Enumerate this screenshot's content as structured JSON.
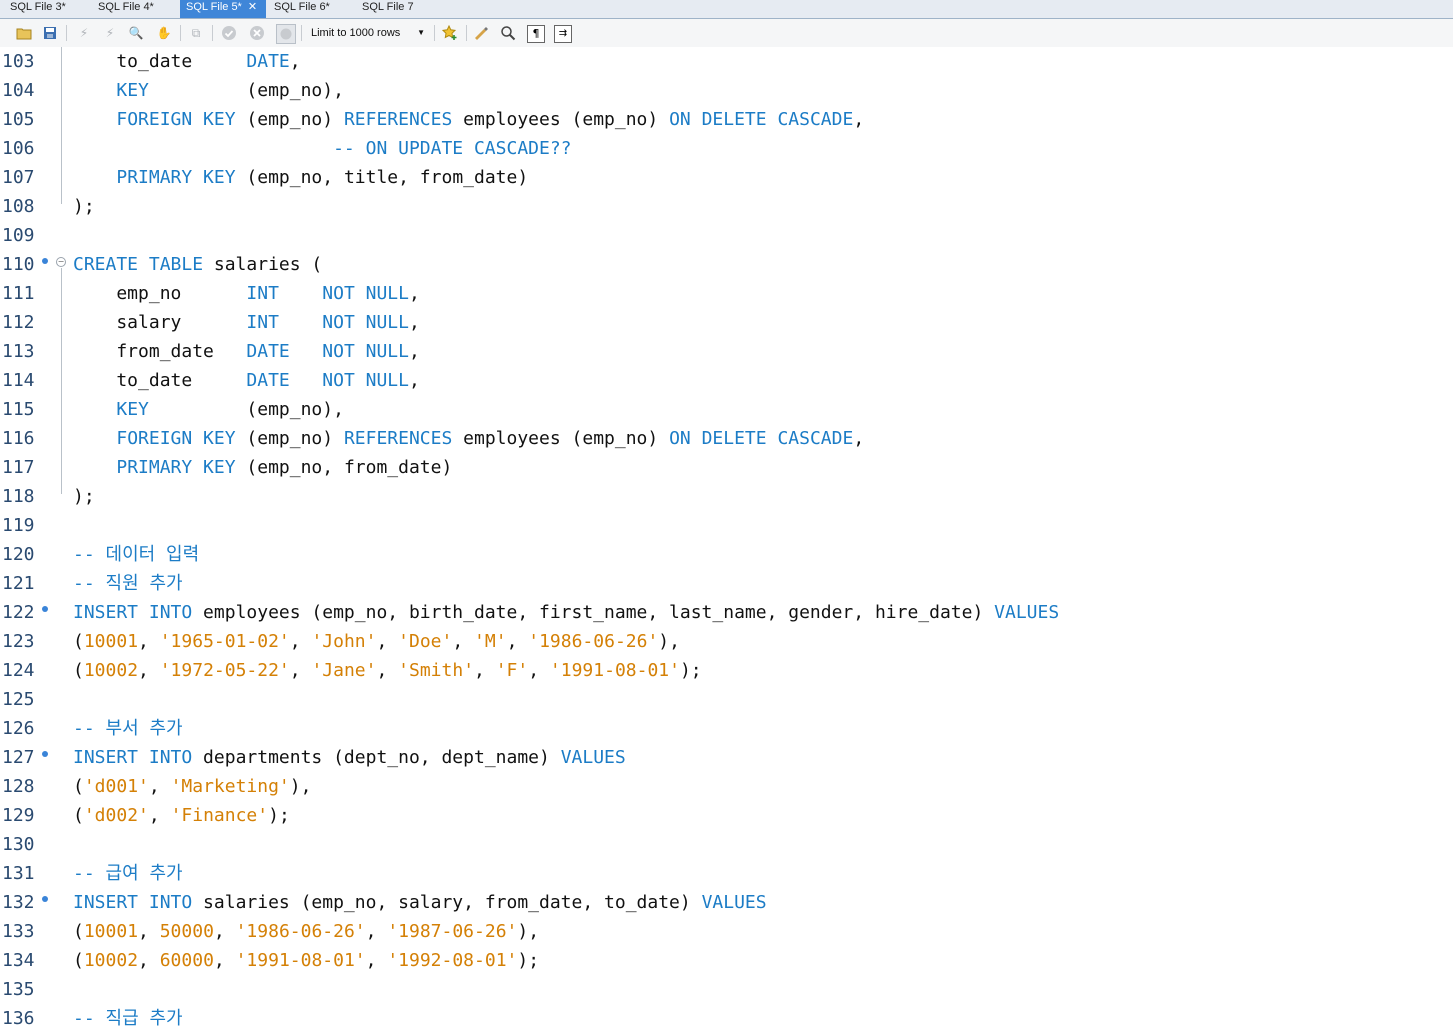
{
  "tabs": [
    {
      "label": "SQL File 3*",
      "active": false,
      "closable": false
    },
    {
      "label": "SQL File 4*",
      "active": false,
      "closable": false
    },
    {
      "label": "SQL File 5*",
      "active": true,
      "closable": true
    },
    {
      "label": "SQL File 6*",
      "active": false,
      "closable": false
    },
    {
      "label": "SQL File 7",
      "active": false,
      "closable": false
    }
  ],
  "toolbar": {
    "limit_label": "Limit to 1000 rows",
    "icons": [
      "open-folder-icon",
      "save-icon",
      "execute-icon",
      "execute-selection-icon",
      "explain-icon",
      "stop-icon",
      "toggle-continue-icon",
      "commit-icon",
      "rollback-icon",
      "autocommit-icon",
      "limit-dropdown",
      "add-snippet-icon",
      "beautify-icon",
      "find-icon",
      "invisible-chars-icon",
      "wrap-icon"
    ]
  },
  "colors": {
    "keyword": "#1c7cc6",
    "string": "#d48006",
    "line_number": "#2a4a70",
    "active_tab": "#3f86d8"
  },
  "lines": [
    {
      "n": "103",
      "marker": false,
      "fold": false,
      "segs": [
        [
          "p",
          "    to_date     "
        ],
        [
          "k",
          "DATE"
        ],
        [
          "p",
          ","
        ]
      ]
    },
    {
      "n": "104",
      "marker": false,
      "fold": false,
      "segs": [
        [
          "p",
          "    "
        ],
        [
          "k",
          "KEY"
        ],
        [
          "p",
          "         (emp_no),"
        ]
      ]
    },
    {
      "n": "105",
      "marker": false,
      "fold": false,
      "segs": [
        [
          "p",
          "    "
        ],
        [
          "k",
          "FOREIGN KEY"
        ],
        [
          "p",
          " (emp_no) "
        ],
        [
          "k",
          "REFERENCES"
        ],
        [
          "p",
          " employees (emp_no) "
        ],
        [
          "k",
          "ON DELETE CASCADE"
        ],
        [
          "p",
          ","
        ]
      ]
    },
    {
      "n": "106",
      "marker": false,
      "fold": false,
      "segs": [
        [
          "p",
          "                        "
        ],
        [
          "c",
          "-- ON UPDATE CASCADE??"
        ]
      ]
    },
    {
      "n": "107",
      "marker": false,
      "fold": false,
      "segs": [
        [
          "p",
          "    "
        ],
        [
          "k",
          "PRIMARY KEY"
        ],
        [
          "p",
          " (emp_no, title, from_date)"
        ]
      ]
    },
    {
      "n": "108",
      "marker": false,
      "fold": false,
      "segs": [
        [
          "p",
          ");"
        ]
      ]
    },
    {
      "n": "109",
      "marker": false,
      "fold": false,
      "segs": []
    },
    {
      "n": "110",
      "marker": true,
      "fold": true,
      "segs": [
        [
          "k",
          "CREATE TABLE"
        ],
        [
          "p",
          " salaries ("
        ]
      ]
    },
    {
      "n": "111",
      "marker": false,
      "fold": false,
      "segs": [
        [
          "p",
          "    emp_no      "
        ],
        [
          "k",
          "INT"
        ],
        [
          "p",
          "    "
        ],
        [
          "k",
          "NOT NULL"
        ],
        [
          "p",
          ","
        ]
      ]
    },
    {
      "n": "112",
      "marker": false,
      "fold": false,
      "segs": [
        [
          "p",
          "    salary      "
        ],
        [
          "k",
          "INT"
        ],
        [
          "p",
          "    "
        ],
        [
          "k",
          "NOT NULL"
        ],
        [
          "p",
          ","
        ]
      ]
    },
    {
      "n": "113",
      "marker": false,
      "fold": false,
      "segs": [
        [
          "p",
          "    from_date   "
        ],
        [
          "k",
          "DATE"
        ],
        [
          "p",
          "   "
        ],
        [
          "k",
          "NOT NULL"
        ],
        [
          "p",
          ","
        ]
      ]
    },
    {
      "n": "114",
      "marker": false,
      "fold": false,
      "segs": [
        [
          "p",
          "    to_date     "
        ],
        [
          "k",
          "DATE"
        ],
        [
          "p",
          "   "
        ],
        [
          "k",
          "NOT NULL"
        ],
        [
          "p",
          ","
        ]
      ]
    },
    {
      "n": "115",
      "marker": false,
      "fold": false,
      "segs": [
        [
          "p",
          "    "
        ],
        [
          "k",
          "KEY"
        ],
        [
          "p",
          "         (emp_no),"
        ]
      ]
    },
    {
      "n": "116",
      "marker": false,
      "fold": false,
      "segs": [
        [
          "p",
          "    "
        ],
        [
          "k",
          "FOREIGN KEY"
        ],
        [
          "p",
          " (emp_no) "
        ],
        [
          "k",
          "REFERENCES"
        ],
        [
          "p",
          " employees (emp_no) "
        ],
        [
          "k",
          "ON DELETE CASCADE"
        ],
        [
          "p",
          ","
        ]
      ]
    },
    {
      "n": "117",
      "marker": false,
      "fold": false,
      "segs": [
        [
          "p",
          "    "
        ],
        [
          "k",
          "PRIMARY KEY"
        ],
        [
          "p",
          " (emp_no, from_date)"
        ]
      ]
    },
    {
      "n": "118",
      "marker": false,
      "fold": false,
      "segs": [
        [
          "p",
          ");"
        ]
      ]
    },
    {
      "n": "119",
      "marker": false,
      "fold": false,
      "segs": []
    },
    {
      "n": "120",
      "marker": false,
      "fold": false,
      "segs": [
        [
          "c",
          "-- 데이터 입력"
        ]
      ]
    },
    {
      "n": "121",
      "marker": false,
      "fold": false,
      "segs": [
        [
          "c",
          "-- 직원 추가"
        ]
      ]
    },
    {
      "n": "122",
      "marker": true,
      "fold": false,
      "segs": [
        [
          "k",
          "INSERT INTO"
        ],
        [
          "p",
          " employees (emp_no, birth_date, first_name, last_name, gender, hire_date) "
        ],
        [
          "k",
          "VALUES"
        ]
      ]
    },
    {
      "n": "123",
      "marker": false,
      "fold": false,
      "segs": [
        [
          "p",
          "("
        ],
        [
          "s",
          "10001"
        ],
        [
          "p",
          ", "
        ],
        [
          "s",
          "'1965-01-02'"
        ],
        [
          "p",
          ", "
        ],
        [
          "s",
          "'John'"
        ],
        [
          "p",
          ", "
        ],
        [
          "s",
          "'Doe'"
        ],
        [
          "p",
          ", "
        ],
        [
          "s",
          "'M'"
        ],
        [
          "p",
          ", "
        ],
        [
          "s",
          "'1986-06-26'"
        ],
        [
          "p",
          "),"
        ]
      ]
    },
    {
      "n": "124",
      "marker": false,
      "fold": false,
      "segs": [
        [
          "p",
          "("
        ],
        [
          "s",
          "10002"
        ],
        [
          "p",
          ", "
        ],
        [
          "s",
          "'1972-05-22'"
        ],
        [
          "p",
          ", "
        ],
        [
          "s",
          "'Jane'"
        ],
        [
          "p",
          ", "
        ],
        [
          "s",
          "'Smith'"
        ],
        [
          "p",
          ", "
        ],
        [
          "s",
          "'F'"
        ],
        [
          "p",
          ", "
        ],
        [
          "s",
          "'1991-08-01'"
        ],
        [
          "p",
          ");"
        ]
      ]
    },
    {
      "n": "125",
      "marker": false,
      "fold": false,
      "segs": []
    },
    {
      "n": "126",
      "marker": false,
      "fold": false,
      "segs": [
        [
          "c",
          "-- 부서 추가"
        ]
      ]
    },
    {
      "n": "127",
      "marker": true,
      "fold": false,
      "segs": [
        [
          "k",
          "INSERT INTO"
        ],
        [
          "p",
          " departments (dept_no, dept_name) "
        ],
        [
          "k",
          "VALUES"
        ]
      ]
    },
    {
      "n": "128",
      "marker": false,
      "fold": false,
      "segs": [
        [
          "p",
          "("
        ],
        [
          "s",
          "'d001'"
        ],
        [
          "p",
          ", "
        ],
        [
          "s",
          "'Marketing'"
        ],
        [
          "p",
          "),"
        ]
      ]
    },
    {
      "n": "129",
      "marker": false,
      "fold": false,
      "segs": [
        [
          "p",
          "("
        ],
        [
          "s",
          "'d002'"
        ],
        [
          "p",
          ", "
        ],
        [
          "s",
          "'Finance'"
        ],
        [
          "p",
          ");"
        ]
      ]
    },
    {
      "n": "130",
      "marker": false,
      "fold": false,
      "segs": []
    },
    {
      "n": "131",
      "marker": false,
      "fold": false,
      "segs": [
        [
          "c",
          "-- 급여 추가"
        ]
      ]
    },
    {
      "n": "132",
      "marker": true,
      "fold": false,
      "segs": [
        [
          "k",
          "INSERT INTO"
        ],
        [
          "p",
          " salaries (emp_no, salary, from_date, to_date) "
        ],
        [
          "k",
          "VALUES"
        ]
      ]
    },
    {
      "n": "133",
      "marker": false,
      "fold": false,
      "segs": [
        [
          "p",
          "("
        ],
        [
          "s",
          "10001"
        ],
        [
          "p",
          ", "
        ],
        [
          "s",
          "50000"
        ],
        [
          "p",
          ", "
        ],
        [
          "s",
          "'1986-06-26'"
        ],
        [
          "p",
          ", "
        ],
        [
          "s",
          "'1987-06-26'"
        ],
        [
          "p",
          "),"
        ]
      ]
    },
    {
      "n": "134",
      "marker": false,
      "fold": false,
      "segs": [
        [
          "p",
          "("
        ],
        [
          "s",
          "10002"
        ],
        [
          "p",
          ", "
        ],
        [
          "s",
          "60000"
        ],
        [
          "p",
          ", "
        ],
        [
          "s",
          "'1991-08-01'"
        ],
        [
          "p",
          ", "
        ],
        [
          "s",
          "'1992-08-01'"
        ],
        [
          "p",
          ");"
        ]
      ]
    },
    {
      "n": "135",
      "marker": false,
      "fold": false,
      "segs": []
    },
    {
      "n": "136",
      "marker": false,
      "fold": false,
      "segs": [
        [
          "c",
          "-- 직급 추가"
        ]
      ]
    }
  ]
}
